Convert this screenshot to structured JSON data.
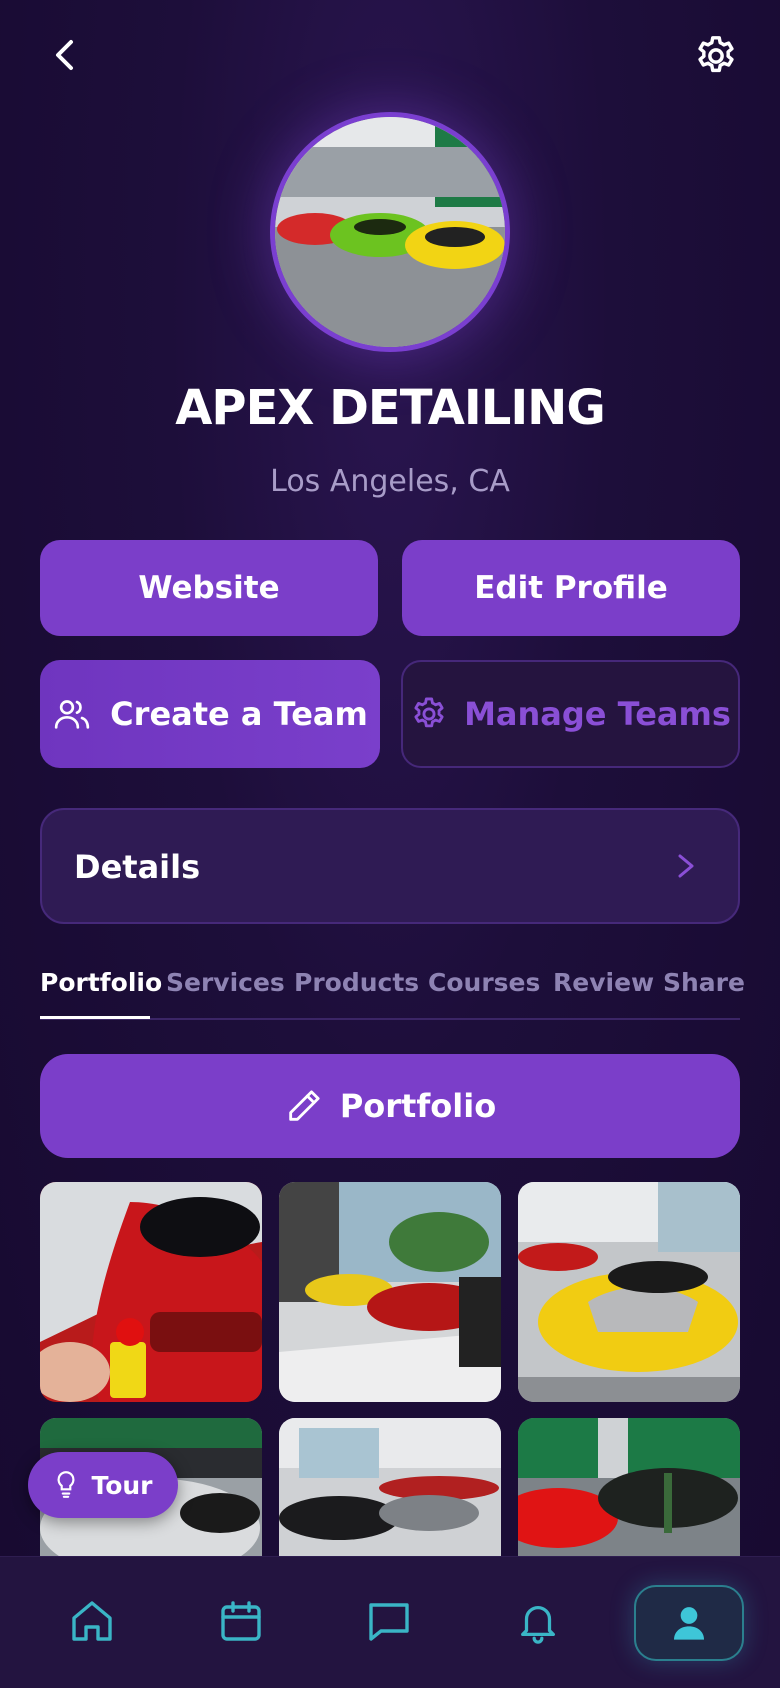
{
  "profile": {
    "name": "APEX DETAILING",
    "location": "Los Angeles, CA"
  },
  "actions": {
    "website_label": "Website",
    "edit_profile_label": "Edit Profile",
    "create_team_label": "Create a Team",
    "manage_teams_label": "Manage Teams"
  },
  "details": {
    "label": "Details"
  },
  "tabs": [
    {
      "label": "Portfolio",
      "active": true
    },
    {
      "label": "Services"
    },
    {
      "label": "Products"
    },
    {
      "label": "Courses"
    },
    {
      "label": "Review"
    },
    {
      "label": "Share"
    }
  ],
  "portfolio_button_label": "Portfolio",
  "tour_label": "Tour",
  "icons": {
    "back": "chevron-left-icon",
    "settings": "gear-icon",
    "team": "users-icon",
    "manage": "gear-icon",
    "details": "chevron-right-icon",
    "portfolio": "pencil-icon",
    "tour": "lightbulb-icon",
    "nav": [
      "home-icon",
      "calendar-icon",
      "chat-icon",
      "bell-icon",
      "user-icon"
    ]
  },
  "colors": {
    "accent": "#7b3ec9",
    "background": "#1d0e3a",
    "nav_accent": "#3ab5c6"
  }
}
